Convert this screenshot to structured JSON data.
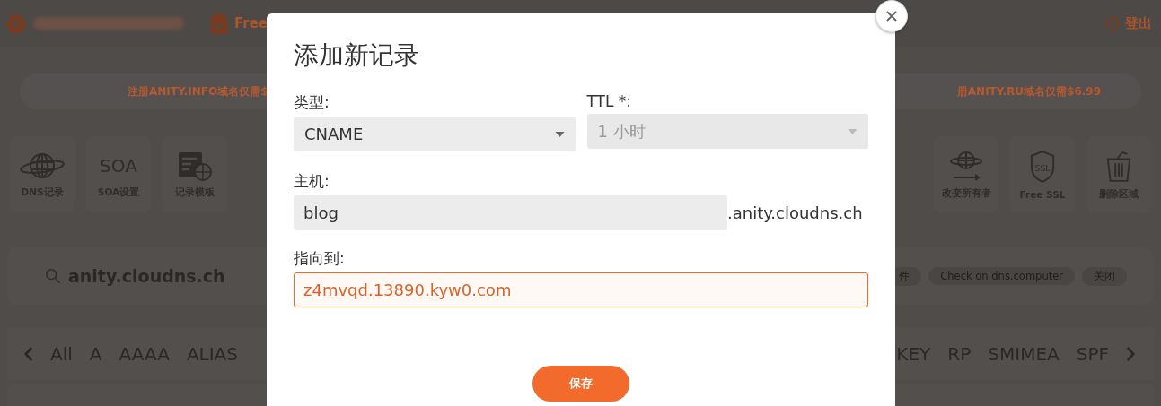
{
  "header": {
    "plan": "Free",
    "logout": "登出"
  },
  "promos": [
    "注册ANITY.INFO域名仅需$",
    "册ANITY.RU域名仅需$6.99"
  ],
  "tools_left": [
    {
      "label": "DNS记录",
      "kind": "globe"
    },
    {
      "label": "SOA设置",
      "kind": "text",
      "icon_text": "SOA"
    },
    {
      "label": "记录模板",
      "kind": "template"
    }
  ],
  "tools_right": [
    {
      "label": "改变所有者",
      "kind": "transfer"
    },
    {
      "label": "Free SSL",
      "kind": "shield",
      "icon_text": "SSL"
    },
    {
      "label": "删除区域",
      "kind": "trash"
    }
  ],
  "zone": {
    "name": "anity.cloudns.ch",
    "actions": [
      "件",
      "Check on dns.computer",
      "关闭"
    ]
  },
  "record_types": {
    "left": [
      "All",
      "A",
      "AAAA",
      "ALIAS"
    ],
    "right": [
      "KEY",
      "RP",
      "SMIMEA",
      "SPF"
    ]
  },
  "dialog": {
    "title": "添加新记录",
    "type": {
      "label": "类型:",
      "value": "CNAME",
      "disabled": false
    },
    "ttl": {
      "label": "TTL *:",
      "value": "1 小时",
      "disabled": true
    },
    "host": {
      "label": "主机:",
      "value": "blog",
      "suffix": ".anity.cloudns.ch"
    },
    "target": {
      "label": "指向到:",
      "value": "z4mvqd.13890.kyw0.com",
      "focused": true
    },
    "save": "保存"
  }
}
